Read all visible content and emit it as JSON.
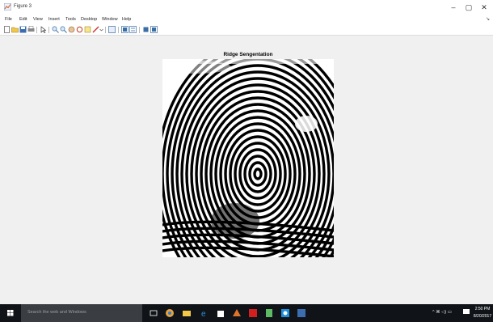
{
  "window": {
    "title": "Figure 3",
    "controls": {
      "minimize": "–",
      "maximize": "▢",
      "close": "✕"
    }
  },
  "menubar": {
    "items": [
      "File",
      "Edit",
      "View",
      "Insert",
      "Tools",
      "Desktop",
      "Window",
      "Help"
    ],
    "overflow": "↘"
  },
  "toolbar": {
    "buttons": [
      "new-figure-icon",
      "open-file-icon",
      "save-icon",
      "print-icon",
      "edit-plot-icon",
      "zoom-in-icon",
      "zoom-out-icon",
      "pan-icon",
      "rotate-3d-icon",
      "data-cursor-icon",
      "brush-icon",
      "link-icon",
      "insert-colorbar-icon",
      "insert-legend-icon",
      "hide-plot-tools-icon",
      "show-plot-tools-icon"
    ]
  },
  "plot": {
    "title": "Ridge Sengentation"
  },
  "taskbar": {
    "search_placeholder": "Search the web and Windows",
    "tray": "^ ⌘ ◁) ▭",
    "clock_time": "2:50 PM",
    "clock_date": "8/20/2017",
    "apps": [
      "task-view-icon",
      "chrome-icon",
      "file-explorer-icon",
      "edge-icon",
      "store-icon",
      "matlab-icon",
      "acrobat-icon",
      "notepad-icon",
      "outlook-icon",
      "photos-icon"
    ]
  },
  "colors": {
    "taskbar": "#101418",
    "search": "#3a3d42",
    "windows_blue": "#1f8fdc"
  }
}
